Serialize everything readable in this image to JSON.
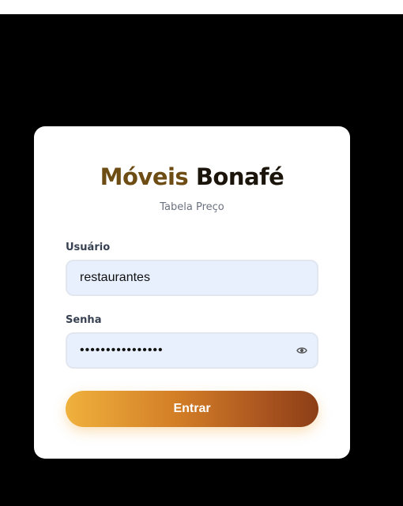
{
  "brand": {
    "name_part1": "Móveis",
    "name_part2": "Bonafé",
    "subtitle": "Tabela Preço",
    "colors": {
      "gold": "#6e4d14",
      "dark": "#1b140a"
    }
  },
  "form": {
    "username": {
      "label": "Usuário",
      "value": "restaurantes"
    },
    "password": {
      "label": "Senha",
      "value": "restaurantes2024",
      "toggle_icon": "eye-icon"
    },
    "submit_label": "Entrar",
    "button_gradient": [
      "#f0b13c",
      "#8c3e16"
    ]
  }
}
